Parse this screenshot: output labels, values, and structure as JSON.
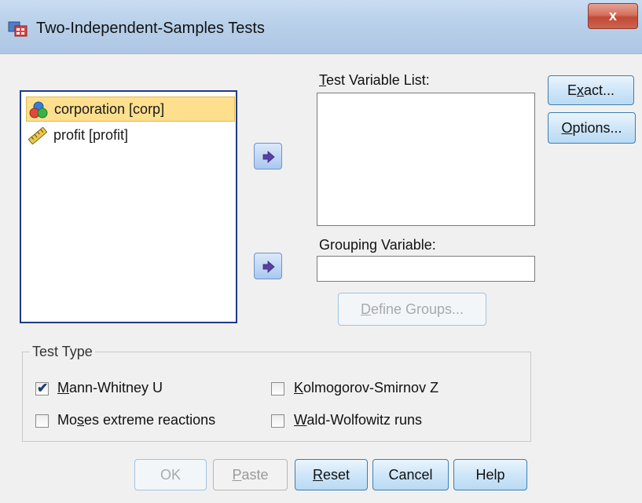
{
  "window": {
    "title": "Two-Independent-Samples Tests",
    "close_label": "x"
  },
  "source_list": {
    "items": [
      {
        "label": "corporation [corp]",
        "icon": "nominal-variable-icon",
        "selected": true
      },
      {
        "label": "profit [profit]",
        "icon": "scale-ruler-icon",
        "selected": false
      }
    ]
  },
  "test_variable": {
    "label_mnemonic": "T",
    "label_rest": "est Variable List:"
  },
  "grouping": {
    "label": "Grouping Variable:",
    "value": ""
  },
  "buttons": {
    "exact_pre": "E",
    "exact_mnemonic": "x",
    "exact_post": "act...",
    "options_mnemonic": "O",
    "options_post": "ptions...",
    "define_mnemonic": "D",
    "define_post": "efine Groups...",
    "ok": "OK",
    "paste_mnemonic": "P",
    "paste_post": "aste",
    "reset_mnemonic": "R",
    "reset_post": "eset",
    "cancel": "Cancel",
    "help": "Help"
  },
  "test_type": {
    "title": "Test Type",
    "options": [
      {
        "pre": "",
        "mnemonic": "M",
        "post": "ann-Whitney U",
        "checked": true
      },
      {
        "pre": "",
        "mnemonic": "K",
        "post": "olmogorov-Smirnov Z",
        "checked": false
      },
      {
        "pre": "Mo",
        "mnemonic": "s",
        "post": "es extreme reactions",
        "checked": false
      },
      {
        "pre": "",
        "mnemonic": "W",
        "post": "ald-Wolfowitz runs",
        "checked": false
      }
    ]
  },
  "colors": {
    "accent": "#1e3a8a",
    "selection": "#fddf8e",
    "arrow": "#5b3ea8"
  }
}
